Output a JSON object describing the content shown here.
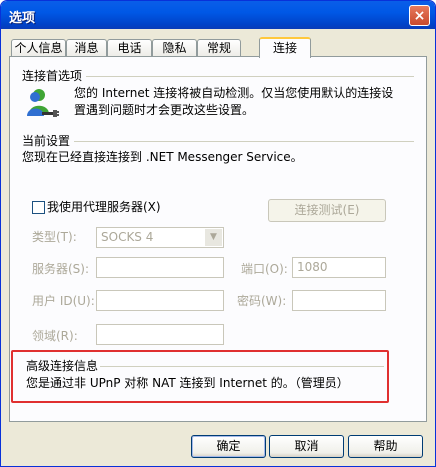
{
  "window": {
    "title": "选项",
    "close_label": "×"
  },
  "tabs": [
    {
      "label": "个人信息"
    },
    {
      "label": "消息"
    },
    {
      "label": "电话"
    },
    {
      "label": "隐私"
    },
    {
      "label": "常规"
    },
    {
      "label": "连接",
      "active": true
    }
  ],
  "preferences": {
    "heading": "连接首选项",
    "description_line1": "您的 Internet 连接将被自动检测。仅当您使用默认的连接设",
    "description_line2": "置遇到问题时才会更改这些设置。"
  },
  "current": {
    "heading": "当前设置",
    "status": "您现在已经直接连接到 .NET Messenger Service。"
  },
  "proxy": {
    "checkbox_label": "我使用代理服务器(X)",
    "checked": false,
    "test_button": "连接测试(E)",
    "type_label": "类型(T):",
    "type_value": "SOCKS 4",
    "server_label": "服务器(S):",
    "server_value": "",
    "port_label": "端口(O):",
    "port_value": "1080",
    "user_label": "用户 ID(U):",
    "user_value": "",
    "password_label": "密码(W):",
    "password_value": "",
    "domain_label": "领域(R):",
    "domain_value": ""
  },
  "advanced": {
    "heading": "高级连接信息",
    "info": "您是通过非 UPnP 对称 NAT 连接到 Internet 的。（管理员）"
  },
  "buttons": {
    "ok": "确定",
    "cancel": "取消",
    "help": "帮助"
  },
  "colors": {
    "highlight_box": "#E03030",
    "title_bar": "#0058E6",
    "active_tab_accent": "#FFC83C"
  }
}
